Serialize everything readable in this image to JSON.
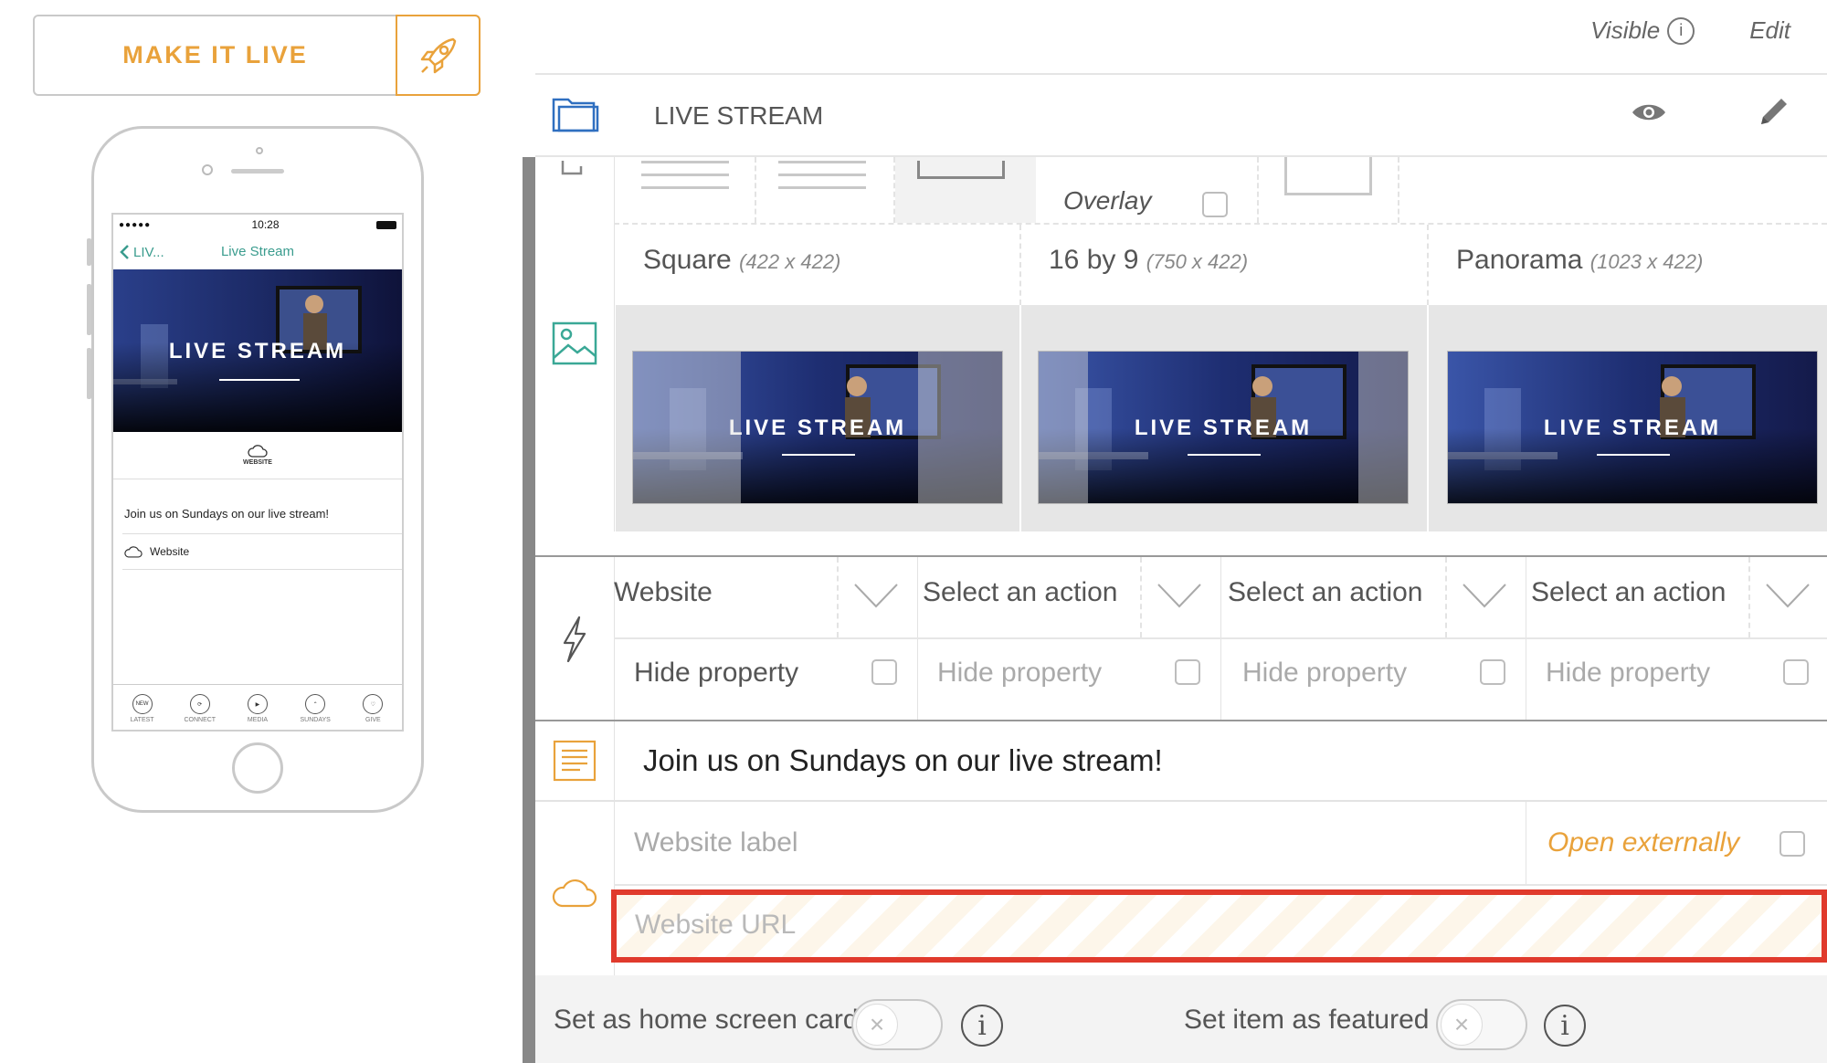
{
  "sidebar": {
    "make_live_label": "MAKE IT LIVE"
  },
  "phone": {
    "status_time": "10:28",
    "back_label": "LIV...",
    "nav_title": "Live Stream",
    "hero_text": "LIVE STREAM",
    "weblink_label": "WEBSITE",
    "description": "Join us on Sundays on our live stream!",
    "website_row": "Website",
    "tabs": [
      "LATEST",
      "CONNECT",
      "MEDIA",
      "SUNDAYS",
      "GIVE"
    ],
    "tab_new_badge": "NEW"
  },
  "toplinks": {
    "visible": "Visible",
    "edit": "Edit"
  },
  "header": {
    "title": "LIVE STREAM"
  },
  "layout": {
    "overlay_label": "Overlay"
  },
  "sizes": [
    {
      "name": "Square",
      "dims": "(422 x 422)"
    },
    {
      "name": "16 by 9",
      "dims": "(750 x 422)"
    },
    {
      "name": "Panorama",
      "dims": "(1023 x 422)"
    }
  ],
  "thumb_text": "LIVE STREAM",
  "actions": {
    "selects": [
      "Website",
      "Select an action",
      "Select an action",
      "Select an action"
    ],
    "hide_property": "Hide property"
  },
  "content": {
    "description": "Join us on Sundays on our live stream!",
    "website_label_placeholder": "Website label",
    "open_externally": "Open externally",
    "website_url_placeholder": "Website URL"
  },
  "bottom": {
    "home_screen_card": "Set as home screen card",
    "featured": "Set item as featured"
  },
  "colors": {
    "accent_orange": "#e9a23b",
    "teal": "#3a9c8e",
    "highlight_red": "#e03a2c",
    "folder_blue": "#2f6fc0"
  }
}
